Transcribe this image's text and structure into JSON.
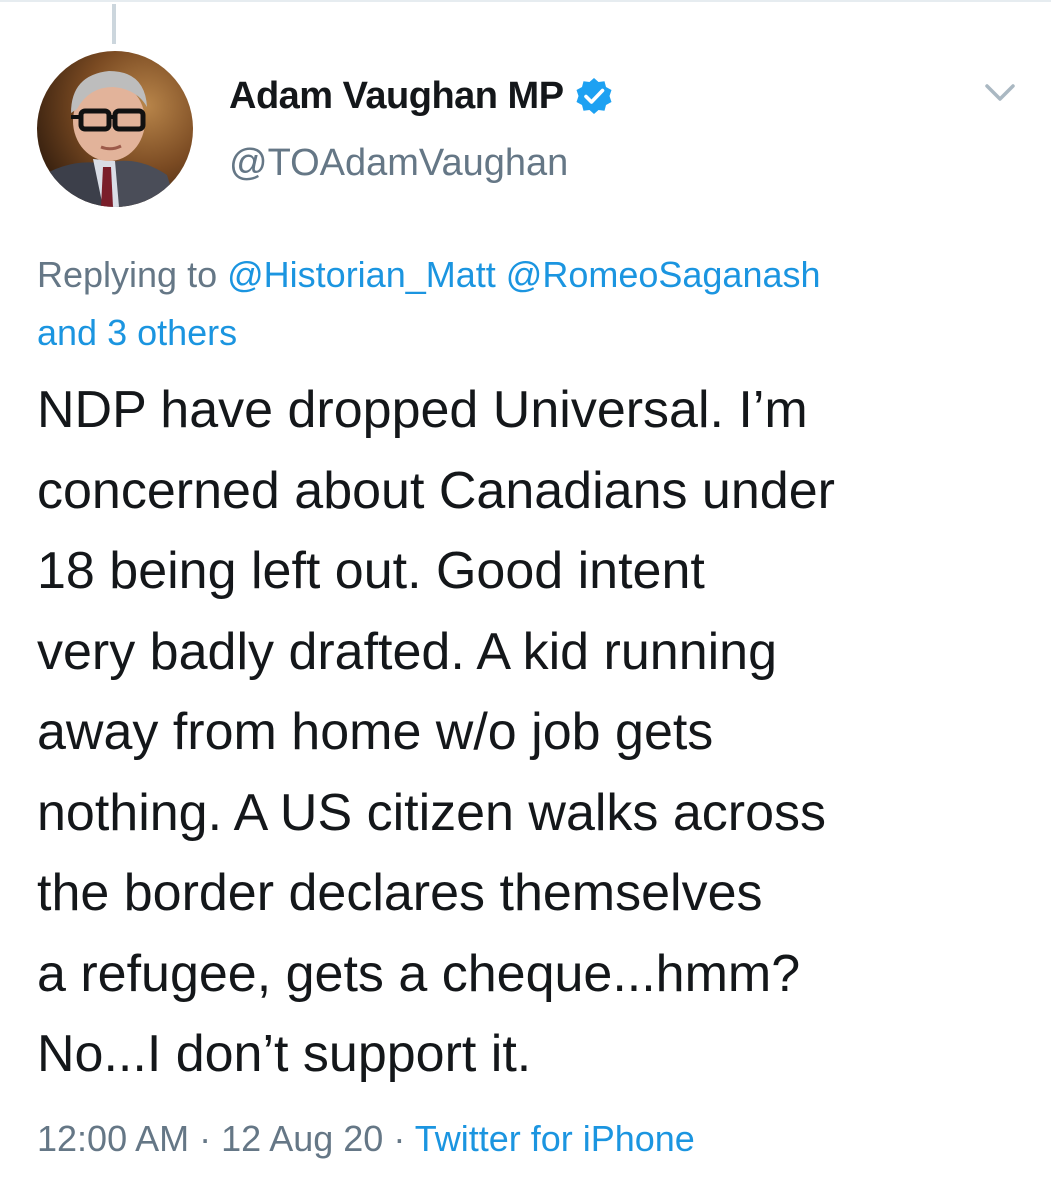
{
  "tweet": {
    "author": {
      "display_name": "Adam Vaughan MP",
      "handle": "@TOAdamVaughan",
      "verified": true,
      "avatar_icon": "person-photo-avatar"
    },
    "reply_context": {
      "prefix": "Replying to",
      "mentions": [
        "@Historian_Matt",
        "@RomeoSaganash"
      ],
      "others": "and 3 others"
    },
    "text": "NDP have dropped Universal. I’m\nconcerned about Canadians under\n18 being left out. Good intent\nvery badly drafted. A kid running\naway from home w/o job gets\nnothing. A US citizen walks across\nthe border declares themselves\na refugee, gets a cheque...hmm?\nNo...I don’t support it.",
    "time": "12:00 AM",
    "date": "12 Aug 20",
    "separator": "·",
    "source": "Twitter for iPhone"
  },
  "colors": {
    "text_primary": "#14171a",
    "text_secondary": "#657786",
    "link": "#1b95e0",
    "verified": "#1da1f2",
    "thread_line": "#ccd6dd"
  }
}
